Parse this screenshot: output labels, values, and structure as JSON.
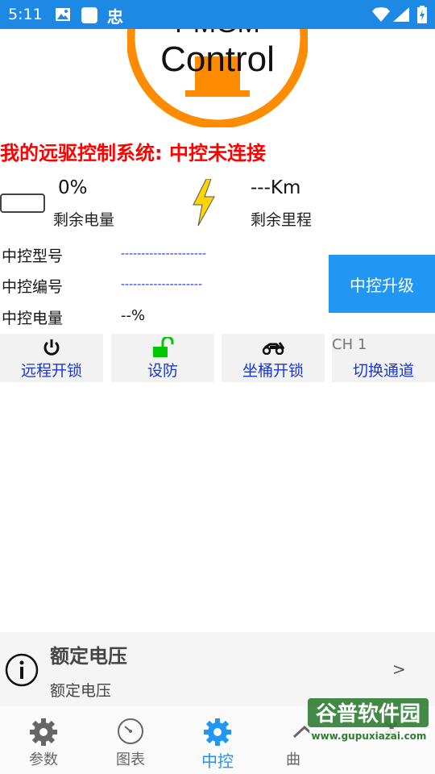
{
  "status_bar": {
    "time": "5:11",
    "app_glyph": "忠"
  },
  "logo": {
    "line1": "PMGM",
    "line2": "Control"
  },
  "header": {
    "title": "我的远驱控制系统: 中控未连接"
  },
  "battery": {
    "value": "0%",
    "label": "剩余电量"
  },
  "range": {
    "value": "---Km",
    "label": "剩余里程"
  },
  "details": [
    {
      "label": "中控型号",
      "value": "---------------------"
    },
    {
      "label": "中控编号",
      "value": "--------------------"
    },
    {
      "label": "中控电量",
      "value": "--%"
    }
  ],
  "upgrade_button": "中控升级",
  "actions": [
    {
      "label": "远程开锁",
      "icon": "power-icon"
    },
    {
      "label": "设防",
      "icon": "unlocked-padlock-icon"
    },
    {
      "label": "坐桶开锁",
      "icon": "scooter-icon"
    },
    {
      "label": "切换通道",
      "channel": "CH 1"
    }
  ],
  "notice": {
    "title": "额定电压",
    "subtitle": "额定电压",
    "chevron": ">"
  },
  "nav": [
    {
      "label": "参数",
      "icon": "gear-icon"
    },
    {
      "label": "图表",
      "icon": "gauge-icon"
    },
    {
      "label": "中控",
      "icon": "gear-icon",
      "active": true
    },
    {
      "label": "曲",
      "icon": "chevron-up-icon"
    },
    {
      "label": "",
      "icon": "bluetooth-icon"
    }
  ],
  "watermark": {
    "text": "谷普软件园",
    "url": "www.gupuxiazai.com"
  },
  "colors": {
    "accent": "#2196f3",
    "title": "#ff0000",
    "link_blue": "#1a37d6",
    "lock_green": "#00c800",
    "logo_orange": "#ff8c00"
  }
}
